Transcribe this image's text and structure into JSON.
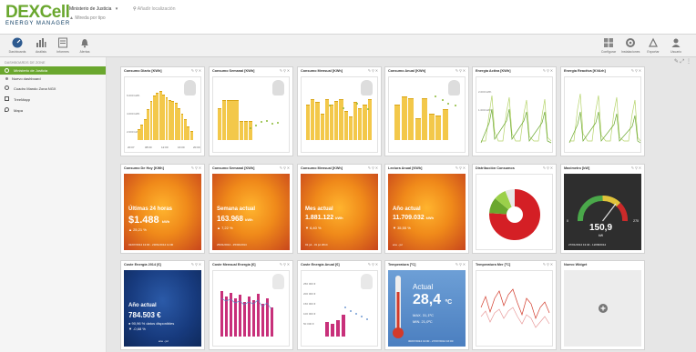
{
  "header": {
    "logo_main": "DEXCell",
    "logo_sub": "ENERGY MANAGER",
    "ministry": "Ministerio de Justicia",
    "panel": "Mireda por tipo",
    "location": "Añadir localización"
  },
  "toolbar": {
    "left": [
      "Dashboards",
      "Análisis",
      "Informes",
      "Alertas"
    ],
    "right": [
      "Configurar",
      "Instalaciones",
      "Exportar",
      "Usuario"
    ]
  },
  "sidebar": {
    "title": "DASHBOARDS DE ZONE",
    "items": [
      {
        "label": "Ministerio de Justicia"
      },
      {
        "label": "Nuevo dashboard"
      },
      {
        "label": "Cuadro Mando Zona NGX"
      },
      {
        "label": "TreeMapp"
      },
      {
        "label": "Mapa"
      }
    ]
  },
  "widgets_row1": [
    {
      "title": "Consumo Diario [KWh]"
    },
    {
      "title": "Consumo Semanal [KWh]"
    },
    {
      "title": "Consumo Mensual [KWh]"
    },
    {
      "title": "Consumo Anual [KWh]"
    },
    {
      "title": "Energía Activa [KWh]"
    },
    {
      "title": "Energía Reactiva [KVArh]"
    }
  ],
  "widgets_row2": [
    {
      "title": "Consumo De Hoy [KWh]",
      "line1": "Últimas 24 horas",
      "value": "$1.488",
      "unit": "kWh",
      "pct": "25,21 %",
      "footer": "31/07/2014 13:00 - 23/01/2014 11:00"
    },
    {
      "title": "Consumo Semanal [KWh]",
      "line1": "Semana actual",
      "value": "163.968",
      "unit": "kWh",
      "pct": "7,22 %",
      "footer": "25/01/2014 - 25/02/2014"
    },
    {
      "title": "Consumo Mensual [KWh]",
      "line1": "Mes actual",
      "value": "1.881.122",
      "unit": "kWh",
      "pct": "6,40 %",
      "footer": "01 jul - 31 jul 2014"
    },
    {
      "title": "Lectura Anual [KWh]",
      "line1": "Año actual",
      "value": "11.709.032",
      "unit": "kWh",
      "pct": "35,55 %",
      "footer": "ene - jul"
    },
    {
      "title": "Distribución Consumos"
    },
    {
      "title": "Maximetro [kW]",
      "value": "150,9",
      "unit": "kW",
      "min": "0",
      "max": "270",
      "footer": "27/01/2014 13:40 - 12/08/2014"
    }
  ],
  "widgets_row3": [
    {
      "title": "Coste Energía 2014 [€]",
      "line1": "Año actual",
      "value": "784.503 €",
      "pct1": "90,96 % datos disponibles",
      "pct2": "-0,68 %",
      "footer": "ene - jul"
    },
    {
      "title": "Coste Mensual Energía [€]"
    },
    {
      "title": "Coste Energía Anual [€]",
      "ticks": [
        "250 000 €",
        "200 000 €",
        "150 000 €",
        "100 000 €",
        "50 000 €"
      ]
    },
    {
      "title": "Temperatura [ºC]",
      "line1": "Actual",
      "value": "28,4",
      "unit": "ºC",
      "max": "MAX. 31,1ºC",
      "min": "MIN. 21,0ºC",
      "footer": "30/07/2014 13:00 - 27/07/2014 16:00"
    },
    {
      "title": "Temperatura Mer [ºC]"
    },
    {
      "title": "Nuevo Widget"
    }
  ],
  "charts": {
    "daily_ticks": [
      "6.000 kWh",
      "4.000 kWh",
      "2.000 kWh"
    ],
    "daily_x": [
      "20:07",
      "08:00",
      "12:00",
      "16:00",
      "20:00"
    ],
    "active_ticks": [
      "2.000 kWh",
      "1.000 kWh"
    ]
  },
  "chart_data": [
    {
      "type": "bar",
      "title": "Consumo Diario [KWh]",
      "values": [
        1.2,
        1.8,
        2.4,
        3.5,
        4.5,
        5.1,
        5.4,
        5.6,
        5.2,
        4.9,
        4.6,
        4.4,
        4.2,
        3.6,
        3.0,
        2.4,
        1.6,
        1.0
      ],
      "ylim": [
        0,
        6500
      ]
    },
    {
      "type": "bar",
      "title": "Consumo Semanal [KWh]",
      "values": [
        18,
        23,
        23,
        23,
        23,
        11,
        11,
        11,
        0,
        0,
        0,
        0,
        0,
        0,
        0
      ]
    },
    {
      "type": "bar",
      "title": "Consumo Mensual [KWh]",
      "values": [
        60,
        70,
        65,
        45,
        70,
        60,
        66,
        70,
        50,
        40,
        65,
        55,
        60,
        70
      ]
    },
    {
      "type": "bar",
      "title": "Consumo Anual [KWh]",
      "values": [
        80,
        100,
        95,
        50,
        95,
        60,
        55,
        70
      ]
    },
    {
      "type": "pie",
      "title": "Distribución Consumos",
      "values": [
        76,
        10,
        8,
        6
      ]
    }
  ]
}
